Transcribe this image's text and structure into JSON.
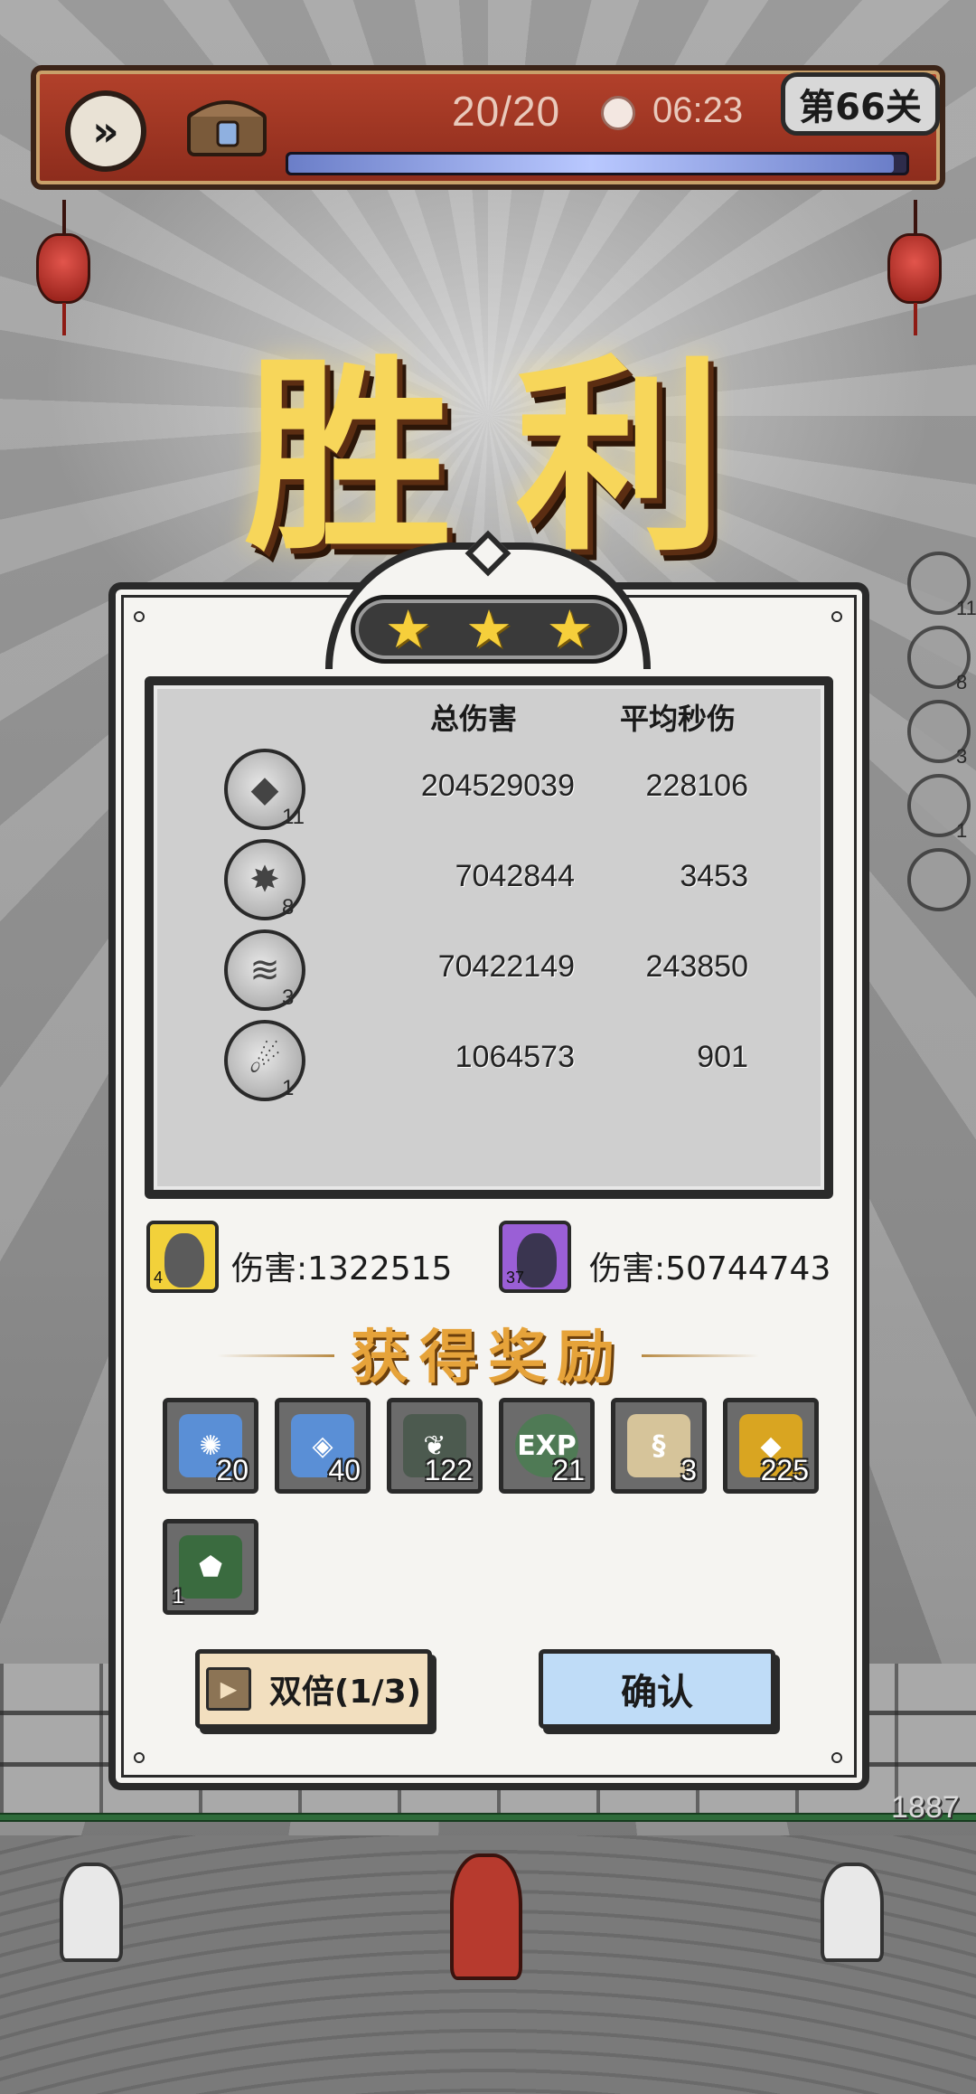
{
  "topbar": {
    "wave_progress": "20/20",
    "timer": "06:23",
    "stage": "第66关",
    "energy_fraction": 0.98
  },
  "victory_title": "胜利",
  "stars": {
    "earned": 3,
    "total": 3
  },
  "stats": {
    "headers": {
      "total_damage": "总伤害",
      "avg_dps": "平均秒伤"
    },
    "rows": [
      {
        "icon": "crystal-shard-skill-icon",
        "level": "11",
        "total": "204529039",
        "avg": "228106"
      },
      {
        "icon": "ice-burst-skill-icon",
        "level": "8",
        "total": "7042844",
        "avg": "3453"
      },
      {
        "icon": "tornado-skill-icon",
        "level": "3",
        "total": "70422149",
        "avg": "243850"
      },
      {
        "icon": "meteor-skill-icon",
        "level": "1",
        "total": "1064573",
        "avg": "901"
      }
    ]
  },
  "side_skills": [
    {
      "icon": "crystal-shard-skill-icon",
      "level": "11"
    },
    {
      "icon": "ice-burst-skill-icon",
      "level": "8"
    },
    {
      "icon": "tornado-skill-icon",
      "level": "3"
    },
    {
      "icon": "meteor-skill-icon",
      "level": "1"
    },
    {
      "icon": "empty-slot-icon",
      "level": ""
    }
  ],
  "heroes": [
    {
      "level": "4",
      "damage": "伤害:1322515",
      "frame_color": "#f2d13a"
    },
    {
      "level": "37",
      "damage": "伤害:50744743",
      "frame_color": "#9a5fd6"
    }
  ],
  "rewards_title": "获得奖励",
  "rewards": [
    {
      "icon": "dark-orb-crystal-icon",
      "qty": "20",
      "color": "#5a8fd6"
    },
    {
      "icon": "ice-crystal-icon",
      "qty": "40",
      "color": "#5a8fd6"
    },
    {
      "icon": "green-leaf-emblem-icon",
      "qty": "122",
      "color": "#4c5a4f"
    },
    {
      "icon": "exp-orb-icon",
      "label": "EXP",
      "qty": "21",
      "color": "#4f7a55"
    },
    {
      "icon": "scroll-icon",
      "qty": "3",
      "color": "#d6c49a"
    },
    {
      "icon": "gold-coin-icon",
      "qty": "225",
      "color": "#d9a521"
    },
    {
      "icon": "green-gem-fragment-icon",
      "qty": "1",
      "color": "#3a6b3f"
    }
  ],
  "buttons": {
    "double": "双倍(1/3)",
    "confirm": "确认"
  },
  "score": "1887",
  "colors": {
    "topbar": "#a23826",
    "star": "#f6cf3b",
    "reward_title": "#e6a33a",
    "double_button": "#f2dfbf",
    "confirm_button": "#bfdcf7"
  }
}
